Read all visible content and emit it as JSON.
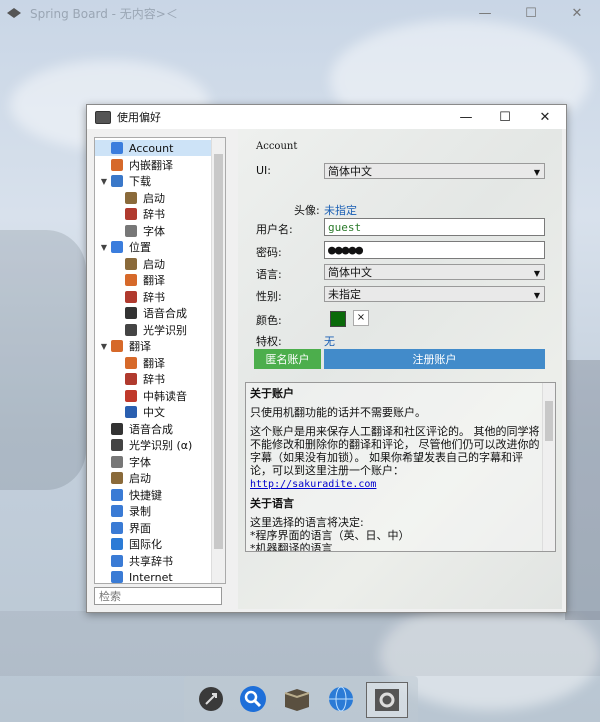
{
  "app": {
    "title": "Spring Board - 无内容>＜"
  },
  "dialog": {
    "title": "使用偏好"
  },
  "tree": {
    "items": [
      {
        "label": "Account",
        "icon": "user-icon",
        "level": 1,
        "selected": true
      },
      {
        "label": "内嵌翻译",
        "icon": "translate-icon",
        "level": 1
      },
      {
        "label": "下载",
        "icon": "download-icon",
        "level": 1,
        "expanded": true
      },
      {
        "label": "启动",
        "icon": "launch-icon",
        "level": 2
      },
      {
        "label": "辞书",
        "icon": "dictionary-icon",
        "level": 2
      },
      {
        "label": "字体",
        "icon": "font-icon",
        "level": 2
      },
      {
        "label": "位置",
        "icon": "location-icon",
        "level": 1,
        "expanded": true
      },
      {
        "label": "启动",
        "icon": "launch-icon",
        "level": 2
      },
      {
        "label": "翻译",
        "icon": "translate-icon",
        "level": 2
      },
      {
        "label": "辞书",
        "icon": "dictionary-icon",
        "level": 2
      },
      {
        "label": "语音合成",
        "icon": "speaker-icon",
        "level": 2
      },
      {
        "label": "光学识别",
        "icon": "camera-icon",
        "level": 2
      },
      {
        "label": "翻译",
        "icon": "translate-icon",
        "level": 1,
        "expanded": true
      },
      {
        "label": "翻译",
        "icon": "translate-icon",
        "level": 2
      },
      {
        "label": "辞书",
        "icon": "dictionary-icon",
        "level": 2
      },
      {
        "label": "中韩读音",
        "icon": "voice-icon",
        "level": 2
      },
      {
        "label": "中文",
        "icon": "chinese-icon",
        "level": 2
      },
      {
        "label": "语音合成",
        "icon": "speaker-icon",
        "level": 1
      },
      {
        "label": "光学识别 (α)",
        "icon": "camera-icon",
        "level": 1
      },
      {
        "label": "字体",
        "icon": "font-icon",
        "level": 1
      },
      {
        "label": "启动",
        "icon": "launch-icon",
        "level": 1
      },
      {
        "label": "快捷键",
        "icon": "keyboard-icon",
        "level": 1
      },
      {
        "label": "录制",
        "icon": "record-icon",
        "level": 1
      },
      {
        "label": "界面",
        "icon": "interface-icon",
        "level": 1
      },
      {
        "label": "国际化",
        "icon": "globe-icon",
        "level": 1
      },
      {
        "label": "共享辞书",
        "icon": "shared-dictionary-icon",
        "level": 1
      },
      {
        "label": "Internet",
        "icon": "internet-icon",
        "level": 1
      }
    ],
    "search_placeholder": "检索"
  },
  "panel": {
    "section_title": "Account",
    "ui_label": "UI:",
    "ui_value": "简体中文",
    "avatar_label": "头像:",
    "avatar_value": "未指定",
    "username_label": "用户名:",
    "username_value": "guest",
    "password_label": "密码:",
    "password_value": "●●●●●",
    "language_label": "语言:",
    "language_value": "简体中文",
    "gender_label": "性别:",
    "gender_value": "未指定",
    "color_label": "颜色:",
    "color_swatch": "#0a6a0a",
    "color_clear": "×",
    "rights_label": "特权:",
    "rights_value": "无",
    "anon_button": "匿名账户",
    "register_button": "注册账户"
  },
  "info": {
    "heading1": "关于账户",
    "para1": "只使用机翻功能的话并不需要账户。",
    "para2": "这个账户是用来保存人工翻译和社区评论的。 其他的同学将不能修改和删除你的翻译和评论， 尽管他们仍可以改进你的字幕（如果没有加锁）。 如果你希望发表自己的字幕和评论，可以到这里注册一个账户：",
    "link": "http://sakuradite.com",
    "heading2": "关于语言",
    "para3": "这里选择的语言将决定:",
    "bullet1": "*程序界面的语言（英、日、中）",
    "bullet2": "*机器翻译的语言"
  },
  "dock": {
    "items": [
      "rocket-icon",
      "search-icon",
      "book-icon",
      "globe-icon",
      "settings-icon"
    ]
  },
  "colors": {
    "green": "#4cae4c",
    "blue": "#428bca",
    "selection": "#cde3f7"
  }
}
